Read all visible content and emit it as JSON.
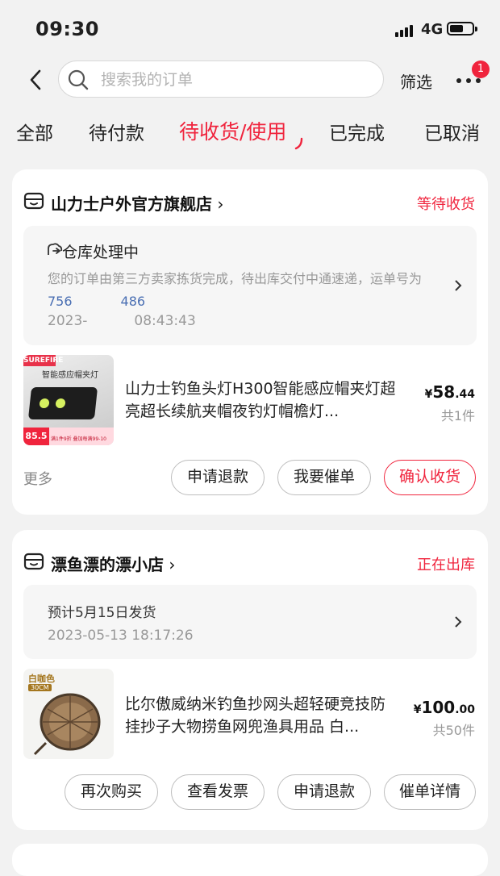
{
  "status_bar": {
    "time": "09:30",
    "network": "4G",
    "battery_level": 0.6
  },
  "nav": {
    "search_placeholder": "搜索我的订单",
    "filter_label": "筛选",
    "more_badge": "1"
  },
  "tabs": [
    {
      "label": "全部"
    },
    {
      "label": "待付款"
    },
    {
      "label": "待收货/使用",
      "active": true
    },
    {
      "label": "已完成"
    },
    {
      "label": "已取消"
    }
  ],
  "orders": [
    {
      "shop_name": "山力士户外官方旗舰店",
      "status": "等待收货",
      "logistics": {
        "title": "仓库处理中",
        "desc_prefix": "您的订单由第三方卖家拣货完成，待出库交付中通速递，运单号为",
        "tracking": "756",
        "tracking_end": "486",
        "time": "2023-",
        "time_end": "08:43:43"
      },
      "product": {
        "title": "山力士钓鱼头灯H300智能感应帽夹灯超亮超长续航夹帽夜钓灯帽檐灯...",
        "price_symbol": "¥",
        "price_int": "58",
        "price_dec": ".44",
        "qty": "共1件",
        "thumb_brand": "SUREFIRE",
        "thumb_caption": "智能感应帽夹灯",
        "thumb_price": "85.5",
        "thumb_promo": "满1件9折 叠加每满99-10"
      },
      "more": "更多",
      "buttons": [
        "申请退款",
        "我要催单",
        "确认收货"
      ]
    },
    {
      "shop_name": "漂鱼漂的漂小店",
      "status": "正在出库",
      "logistics": {
        "title": "预计5月15日发货",
        "time": "2023-05-13 18:17:26"
      },
      "product": {
        "title": "比尔傲威纳米钓鱼抄网头超轻硬竞技防挂抄子大物捞鱼网兜渔具用品 白...",
        "price_symbol": "¥",
        "price_int": "100",
        "price_dec": ".00",
        "qty": "共50件",
        "thumb_label": "白咖色",
        "thumb_size": "30CM"
      },
      "buttons": [
        "再次购买",
        "查看发票",
        "申请退款",
        "催单详情"
      ]
    }
  ],
  "colors": {
    "accent": "#f0243d",
    "link": "#4a6fb3",
    "bg": "#f2f2f2"
  }
}
